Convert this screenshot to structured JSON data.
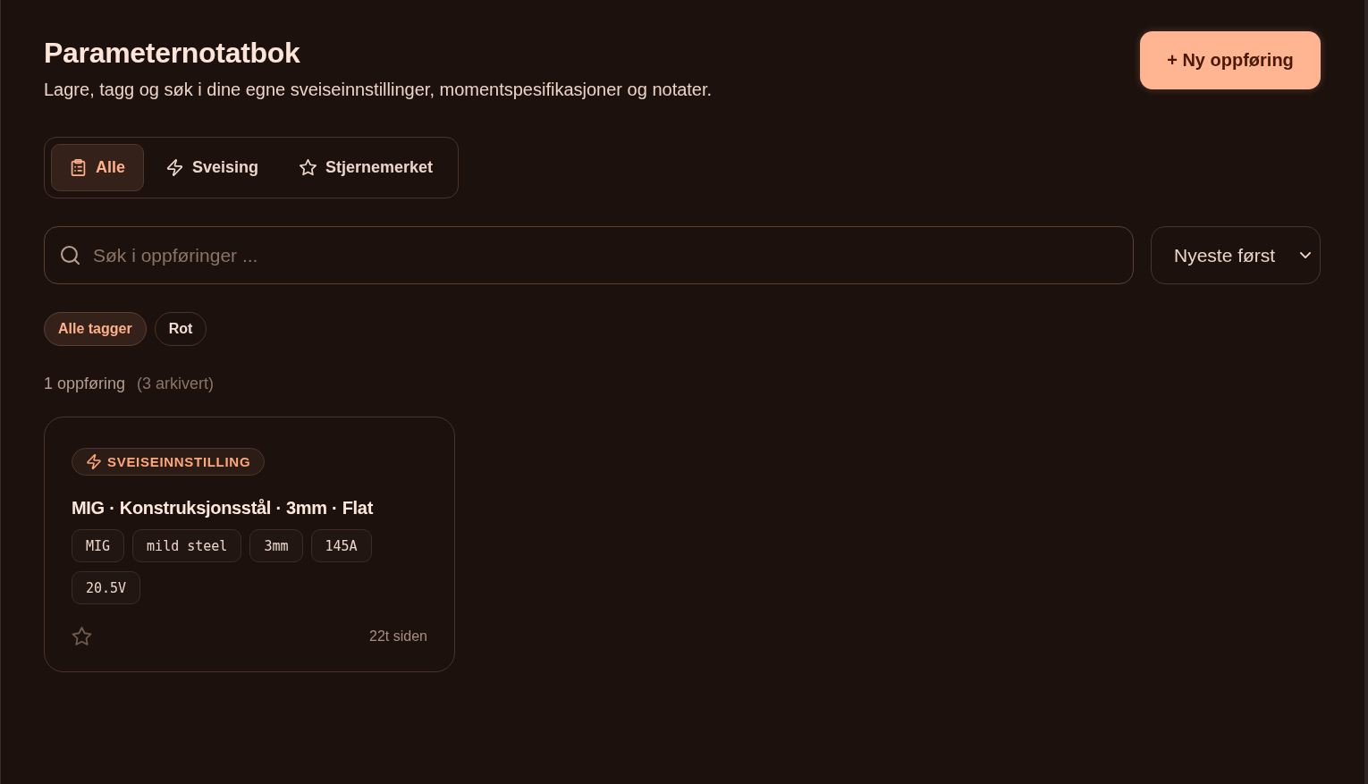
{
  "header": {
    "title": "Parameternotatbok",
    "subtitle": "Lagre, tagg og søk i dine egne sveiseinnstillinger, momentspesifikasjoner og notater.",
    "new_button": "+ Ny oppføring"
  },
  "tabs": [
    {
      "label": "Alle",
      "kind": "all",
      "selected": true
    },
    {
      "label": "Sveising",
      "kind": "welding",
      "selected": false
    },
    {
      "label": "Stjernemerket",
      "kind": "starred",
      "selected": false
    }
  ],
  "search": {
    "placeholder": "Søk i oppføringer ..."
  },
  "sort": {
    "value": "Nyeste først"
  },
  "tag_filters": [
    {
      "label": "Alle tagger",
      "selected": true
    },
    {
      "label": "Rot",
      "selected": false
    }
  ],
  "summary": {
    "count": "1 oppføring",
    "archived": "(3 arkivert)"
  },
  "entries": [
    {
      "category": "SVEISEINNSTILLING",
      "kind": "welding",
      "title": "MIG · Konstruksjonsstål · 3mm · Flat",
      "tags": [
        "MIG",
        "mild steel",
        "3mm",
        "145A",
        "20.5V"
      ],
      "starred": false,
      "age": "22t siden"
    }
  ]
}
